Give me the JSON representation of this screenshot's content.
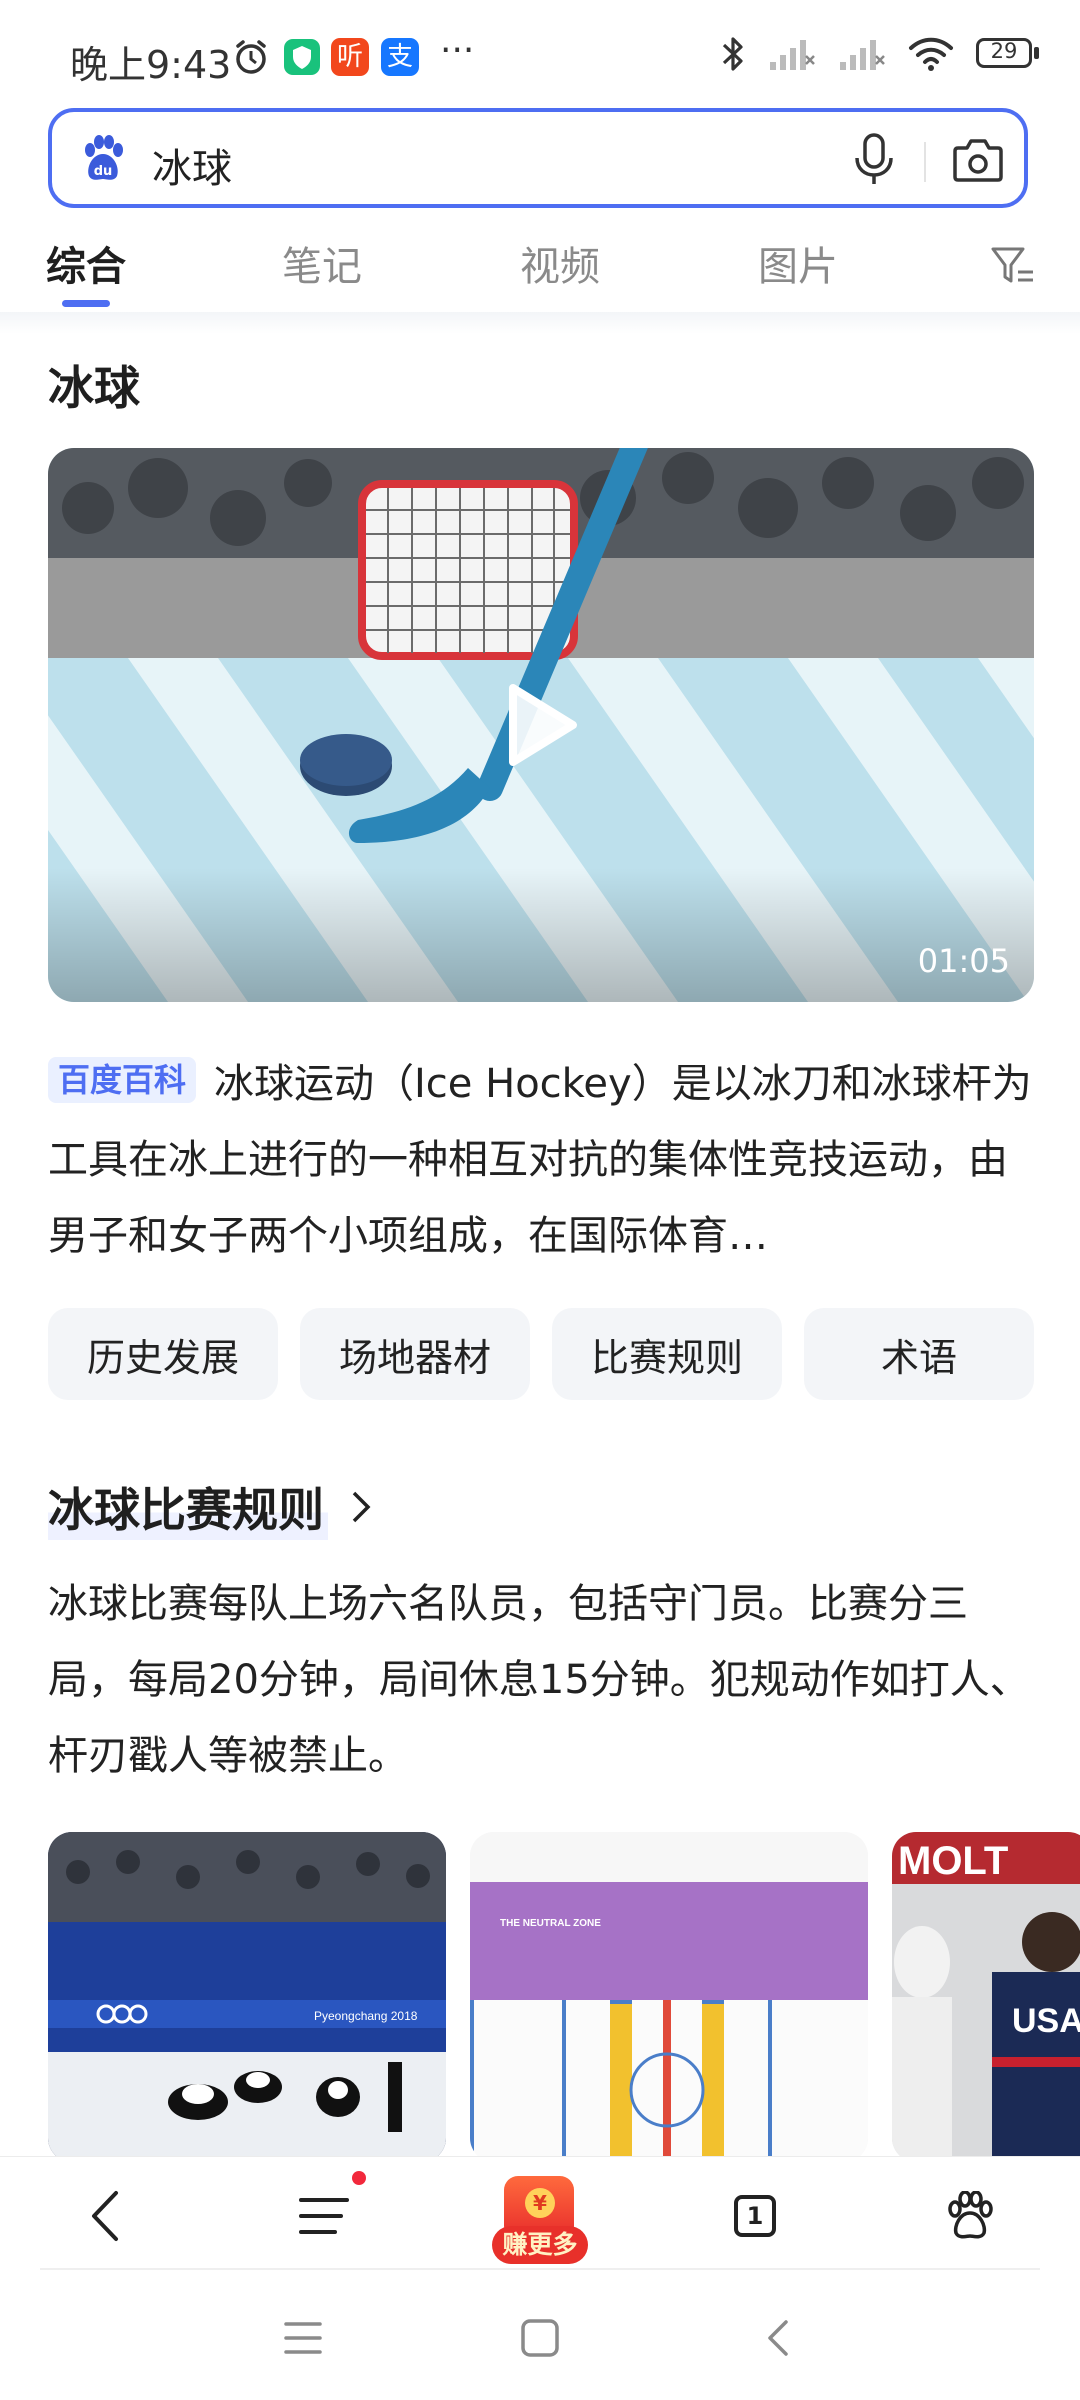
{
  "status_bar": {
    "time": "晚上9:43",
    "app_icon_labels": [
      "听",
      "支"
    ],
    "more": "···",
    "battery": "29"
  },
  "search": {
    "query": "冰球"
  },
  "tabs": [
    {
      "label": "综合",
      "active": true
    },
    {
      "label": "笔记",
      "active": false
    },
    {
      "label": "视频",
      "active": false
    },
    {
      "label": "图片",
      "active": false
    }
  ],
  "page_title": "冰球",
  "video": {
    "duration": "01:05"
  },
  "baike": {
    "badge": "百度百科",
    "text": "冰球运动（Ice Hockey）是以冰刀和冰球杆为工具在冰上进行的一种相互对抗的集体性竞技运动，由男子和女子两个小项组成，在国际体育…"
  },
  "chips": [
    "历史发展",
    "场地器材",
    "比赛规则",
    "术语"
  ],
  "section": {
    "title": "冰球比赛规则",
    "body": "冰球比赛每队上场六名队员，包括守门员。比赛分三局，每局20分钟，局间休息15分钟。犯规动作如打人、杆刃戳人等被禁止。"
  },
  "thumbnails": [
    {
      "caption": "Pyeongchang 2018"
    },
    {
      "caption": "THE NEUTRAL ZONE"
    },
    {
      "caption": "MOLT",
      "sub": "USA"
    }
  ],
  "toolbar": {
    "earn_label": "赚更多",
    "earn_coin": "¥",
    "tab_count": "1"
  },
  "colors": {
    "accent": "#4e6ef2",
    "badge_bg": "#eaf0ff",
    "chip_bg": "#f3f5f8",
    "red_dot": "#f2283c"
  }
}
